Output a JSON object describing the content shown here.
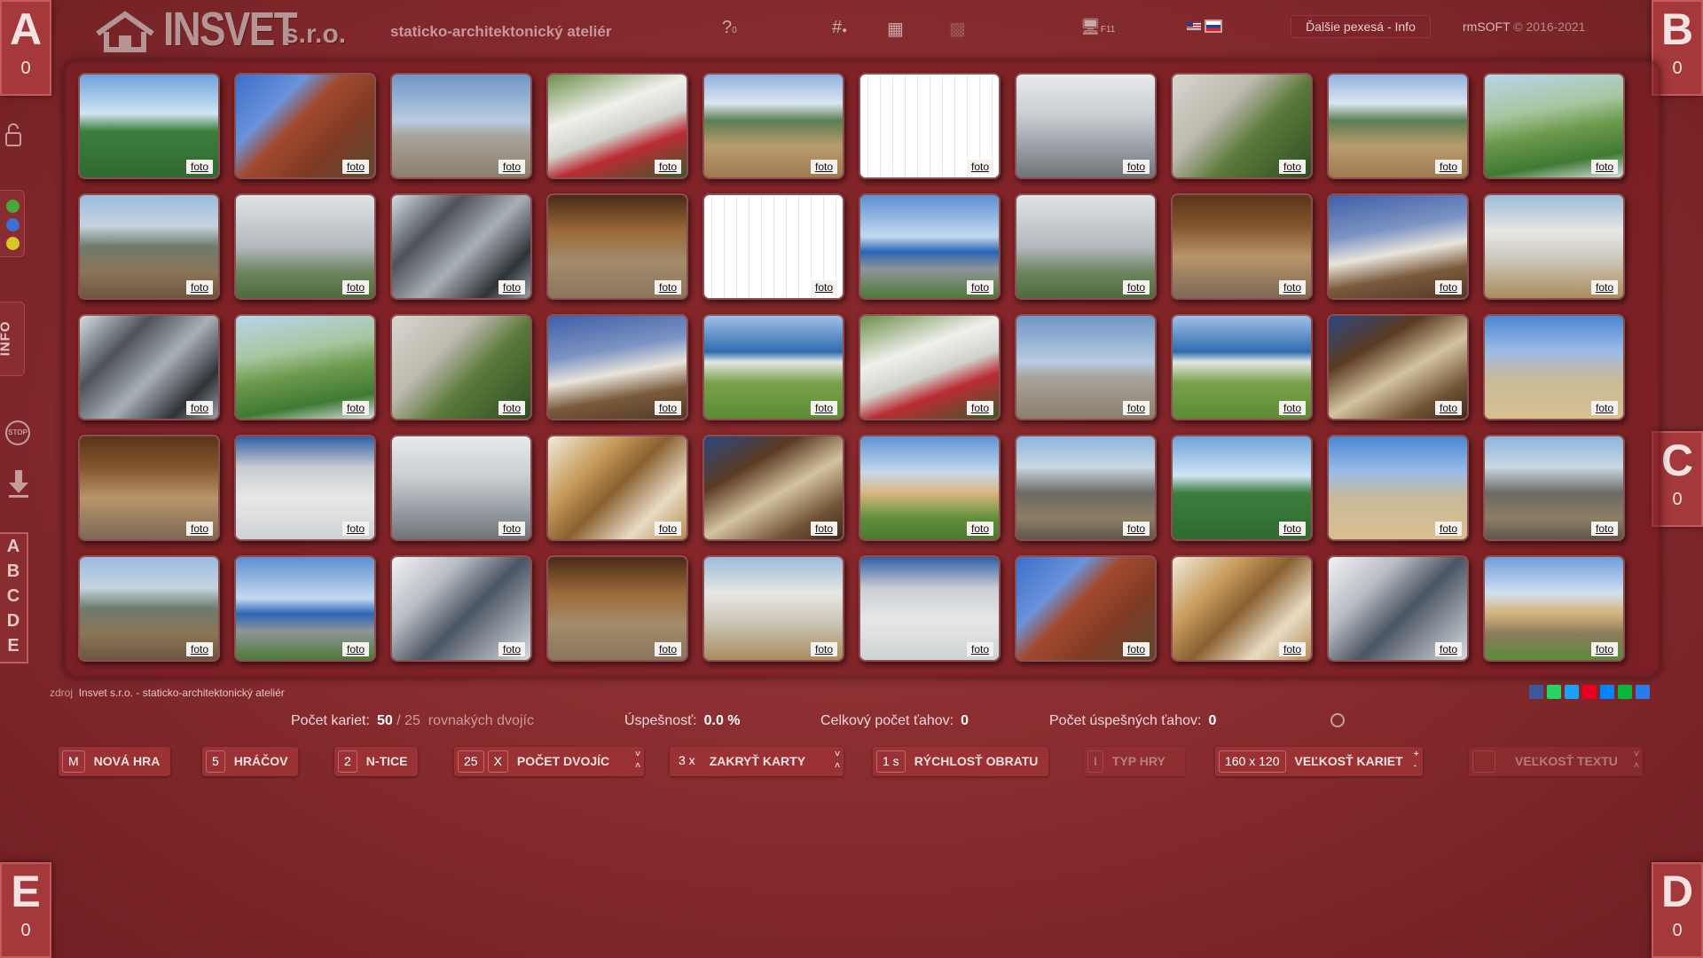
{
  "header": {
    "brand": "INSVET",
    "brand_suffix": "s.r.o.",
    "tagline": "staticko-architektonický ateliér",
    "help_icon": "?",
    "help_count": "0",
    "hash_icon": "#",
    "grid_icon": "grid-icon",
    "monitor_label": "F11",
    "more_button": "Ďalšie pexesá - Info",
    "copyright_brand": "rmSOFT",
    "copyright_years": "© 2016-2021"
  },
  "players": [
    {
      "letter": "A",
      "score": "0"
    },
    {
      "letter": "B",
      "score": "0"
    },
    {
      "letter": "C",
      "score": "0"
    },
    {
      "letter": "D",
      "score": "0"
    },
    {
      "letter": "E",
      "score": "0"
    }
  ],
  "sidebar": {
    "info_label": "INFO",
    "stop_label": "STOP",
    "letters": [
      "A",
      "B",
      "C",
      "D",
      "E"
    ],
    "dot_colors": [
      "#4aa83a",
      "#3f6fd1",
      "#d8c526"
    ]
  },
  "cards": [
    {
      "theme": "stadium",
      "label": "foto"
    },
    {
      "theme": "scaffold",
      "label": "foto"
    },
    {
      "theme": "crane",
      "label": "foto"
    },
    {
      "theme": "house-red",
      "label": "foto"
    },
    {
      "theme": "mountain",
      "label": "foto"
    },
    {
      "theme": "drawing",
      "label": "foto"
    },
    {
      "theme": "interior",
      "label": "foto"
    },
    {
      "theme": "porch",
      "label": "foto"
    },
    {
      "theme": "mountain",
      "label": "foto"
    },
    {
      "theme": "frame",
      "label": "foto"
    },
    {
      "theme": "site",
      "label": "foto"
    },
    {
      "theme": "shed",
      "label": "foto"
    },
    {
      "theme": "glass",
      "label": "foto"
    },
    {
      "theme": "hall",
      "label": "foto"
    },
    {
      "theme": "drawing",
      "label": "foto"
    },
    {
      "theme": "parking",
      "label": "foto"
    },
    {
      "theme": "shed",
      "label": "foto"
    },
    {
      "theme": "barn",
      "label": "foto"
    },
    {
      "theme": "trench",
      "label": "foto"
    },
    {
      "theme": "wall",
      "label": "foto"
    },
    {
      "theme": "glass",
      "label": "foto"
    },
    {
      "theme": "frame",
      "label": "foto"
    },
    {
      "theme": "porch",
      "label": "foto"
    },
    {
      "theme": "trench",
      "label": "foto"
    },
    {
      "theme": "farm",
      "label": "foto"
    },
    {
      "theme": "house-red",
      "label": "foto"
    },
    {
      "theme": "crane",
      "label": "foto"
    },
    {
      "theme": "farm",
      "label": "foto"
    },
    {
      "theme": "arch",
      "label": "foto"
    },
    {
      "theme": "power",
      "label": "foto"
    },
    {
      "theme": "barn",
      "label": "foto"
    },
    {
      "theme": "garage",
      "label": "foto"
    },
    {
      "theme": "interior",
      "label": "foto"
    },
    {
      "theme": "roof",
      "label": "foto"
    },
    {
      "theme": "arch",
      "label": "foto"
    },
    {
      "theme": "villa",
      "label": "foto"
    },
    {
      "theme": "rebar",
      "label": "foto"
    },
    {
      "theme": "stadium",
      "label": "foto"
    },
    {
      "theme": "power",
      "label": "foto"
    },
    {
      "theme": "rebar",
      "label": "foto"
    },
    {
      "theme": "site",
      "label": "foto"
    },
    {
      "theme": "parking",
      "label": "foto"
    },
    {
      "theme": "plant",
      "label": "foto"
    },
    {
      "theme": "hall",
      "label": "foto"
    },
    {
      "theme": "wall",
      "label": "foto"
    },
    {
      "theme": "garage",
      "label": "foto"
    },
    {
      "theme": "scaffold",
      "label": "foto"
    },
    {
      "theme": "roof",
      "label": "foto"
    },
    {
      "theme": "plant",
      "label": "foto"
    },
    {
      "theme": "townhall",
      "label": "foto"
    }
  ],
  "source": {
    "prefix": "zdroj",
    "name": "Insvet s.r.o. - staticko-architektonický ateliér"
  },
  "share_colors": [
    "#3b5998",
    "#25d366",
    "#1da1f2",
    "#e60023",
    "#0084ff",
    "#09b83e",
    "#2d7be5"
  ],
  "stats": {
    "cards_label": "Počet kariet:",
    "cards_value": "50",
    "pairs_sep": "/",
    "pairs_value": "25",
    "pairs_label": "rovnakých dvojíc",
    "success_label": "Úspešnosť:",
    "success_value": "0.0 %",
    "moves_label": "Celkový počet ťahov:",
    "moves_value": "0",
    "success_moves_label": "Počet úspešných ťahov:",
    "success_moves_value": "0"
  },
  "controls": [
    {
      "value": "M",
      "label": "NOVÁ HRA"
    },
    {
      "value": "5",
      "label": "HRÁČOV"
    },
    {
      "value": "2",
      "label": "N-TICE"
    },
    {
      "value": "25",
      "extra": "X",
      "label": "POČET DVOJÍC"
    },
    {
      "value": "3 x",
      "label": "ZAKRYŤ KARTY"
    },
    {
      "value": "1 s",
      "label": "RÝCHLOSŤ OBRATU"
    },
    {
      "value": "I",
      "label": "TYP HRY"
    },
    {
      "value": "160 x 120",
      "label": "VEĽKOSŤ KARIET"
    },
    {
      "value": "",
      "label": "VEĽKOSŤ TEXTU"
    }
  ]
}
